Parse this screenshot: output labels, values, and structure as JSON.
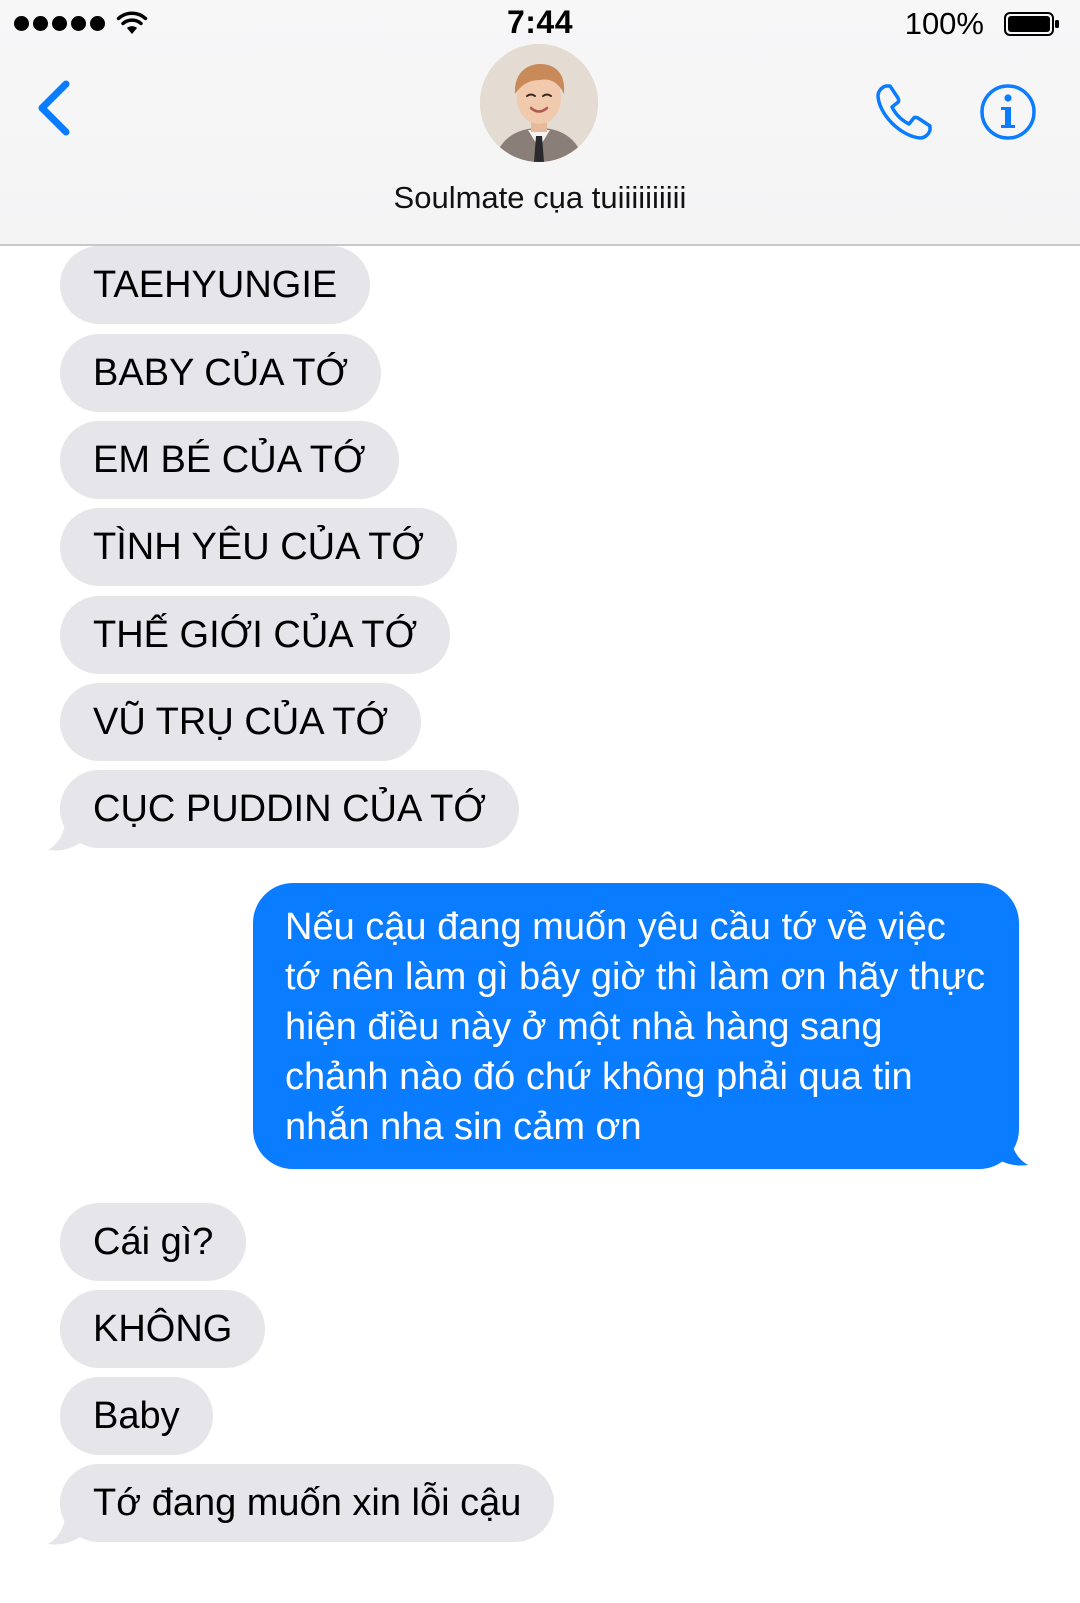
{
  "status_bar": {
    "time": "7:44",
    "battery_percent": "100%"
  },
  "header": {
    "contact_name": "Soulmate cụa tuiiiiiiiiii"
  },
  "messages": [
    {
      "direction": "incoming",
      "text": "TAEHYUNGIE"
    },
    {
      "direction": "incoming",
      "text": "BABY CỦA TỚ"
    },
    {
      "direction": "incoming",
      "text": "EM BÉ CỦA TỚ"
    },
    {
      "direction": "incoming",
      "text": "TÌNH YÊU CỦA TỚ"
    },
    {
      "direction": "incoming",
      "text": "THẾ GIỚI CỦA TỚ"
    },
    {
      "direction": "incoming",
      "text": "VŨ TRỤ CỦA TỚ"
    },
    {
      "direction": "incoming",
      "text": "CỤC PUDDIN CỦA TỚ"
    },
    {
      "direction": "outgoing",
      "text": "Nếu cậu đang muốn yêu cầu tớ về việc tớ nên làm gì bây giờ thì làm ơn hãy thực hiện điều này ở một nhà hàng sang chảnh nào đó chứ không phải qua tin nhắn nha sin cảm ơn"
    },
    {
      "direction": "incoming",
      "text": "Cái gì?"
    },
    {
      "direction": "incoming",
      "text": "KHÔNG"
    },
    {
      "direction": "incoming",
      "text": "Baby"
    },
    {
      "direction": "incoming",
      "text": "Tớ đang muốn xin lỗi cậu"
    }
  ],
  "colors": {
    "accent": "#0a7cff",
    "incoming_bubble": "#e5e5ea",
    "header_background": "#f6f6f7"
  },
  "icons": {
    "back": "chevron-left-icon",
    "call": "phone-icon",
    "info": "info-icon"
  }
}
